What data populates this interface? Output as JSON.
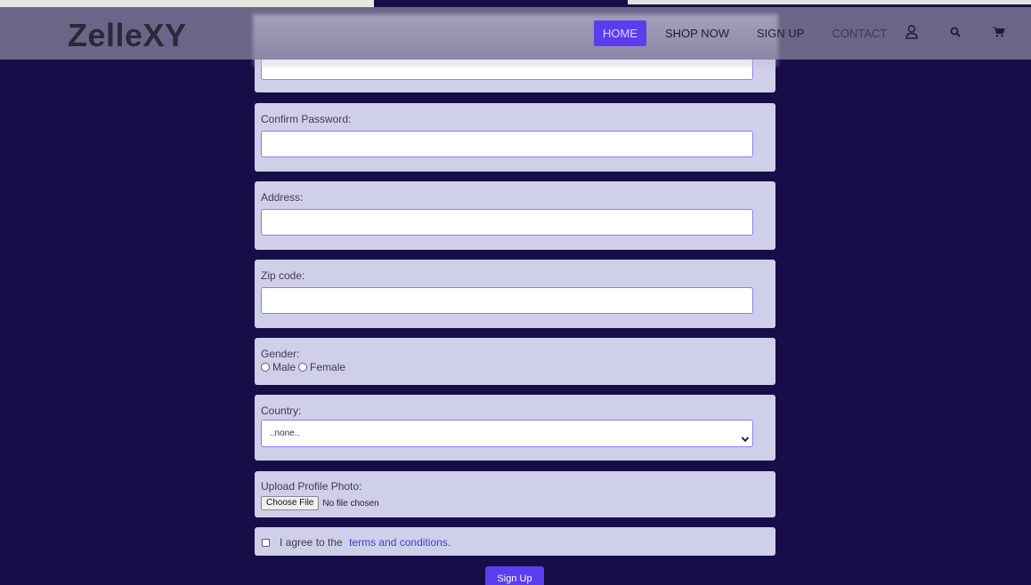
{
  "header": {
    "logo": "ZelleXY",
    "nav": [
      {
        "label": "HOME",
        "active": true
      },
      {
        "label": "SHOP NOW",
        "active": false
      },
      {
        "label": "SIGN UP",
        "active": false
      },
      {
        "label": "CONTACT",
        "active": false
      }
    ],
    "icons": [
      "user-icon",
      "search-icon",
      "cart-icon"
    ],
    "accent": "#5b3cf0",
    "background": "#6a6687"
  },
  "form": {
    "confirm_password": {
      "label": "Confirm Password:",
      "value": ""
    },
    "address": {
      "label": "Address:",
      "value": ""
    },
    "zip": {
      "label": "Zip code:",
      "value": ""
    },
    "gender": {
      "label": "Gender:",
      "options": [
        "Male",
        "Female"
      ]
    },
    "country": {
      "label": "Country:",
      "selected": "..none.."
    },
    "photo": {
      "label": "Upload Profile Photo:",
      "button": "Choose File",
      "status": "No file chosen"
    },
    "terms": {
      "prefix": "I agree to the ",
      "link": "terms and conditions."
    },
    "submit": "Sign Up"
  },
  "colors": {
    "page_background": "#180d48",
    "card": "#d0cfea",
    "input_border": "#8b7ff0",
    "link": "#3b3de0"
  }
}
